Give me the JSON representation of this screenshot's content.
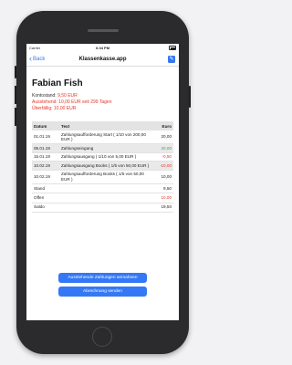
{
  "status_bar": {
    "carrier": "Carrier",
    "time": "6:34 PM"
  },
  "nav": {
    "back_label": "Back",
    "title": "Klassenkasse.app",
    "action_icon": "edit-icon"
  },
  "student": {
    "name": "Fabian Fish",
    "kontostand_label": "Kontostand:",
    "kontostand_value": "9,50 EUR",
    "ausstehend": "Ausstehend: 10,00 EUR seit 299 Tagen",
    "ueberfaellig": "Überfällig: 10,00 EUR"
  },
  "table": {
    "headers": [
      "Datum",
      "Text",
      "Euro"
    ],
    "rows": [
      {
        "date": "01.01.19",
        "text": "Zahlungsaufforderung Start ( 1/10 von 200,00 EUR )",
        "euro": "20,00",
        "color": "#222222",
        "alt": false
      },
      {
        "date": "05.01.19",
        "text": "Zahlungseingang",
        "euro": "20,00",
        "color": "#2fb344",
        "alt": true
      },
      {
        "date": "15.01.19",
        "text": "Zahlungsausgang ( 1/10 von 5,00 EUR )",
        "euro": "-0,50",
        "color": "#e5352b",
        "alt": false
      },
      {
        "date": "10.02.19",
        "text": "Zahlungsausgang Books ( 1/5 von 50,00 EUR )",
        "euro": "-10,00",
        "color": "#e5352b",
        "alt": true
      },
      {
        "date": "10.02.19",
        "text": "Zahlungsaufforderung Books ( 1/5 von 50,00 EUR )",
        "euro": "10,00",
        "color": "#222222",
        "alt": false
      }
    ],
    "summary": [
      {
        "label": "Stand",
        "value": "9,50",
        "color": "#222222"
      },
      {
        "label": "Offen",
        "value": "10,00",
        "color": "#e5352b"
      },
      {
        "label": "Saldo",
        "value": "19,50",
        "color": "#222222"
      }
    ]
  },
  "buttons": {
    "pending_label": "Ausstehende Zahlungen anmahnen",
    "send_label": "Abrechnung senden"
  },
  "colors": {
    "accent": "#3478f6",
    "negative": "#e5352b",
    "positive": "#2fb344"
  }
}
